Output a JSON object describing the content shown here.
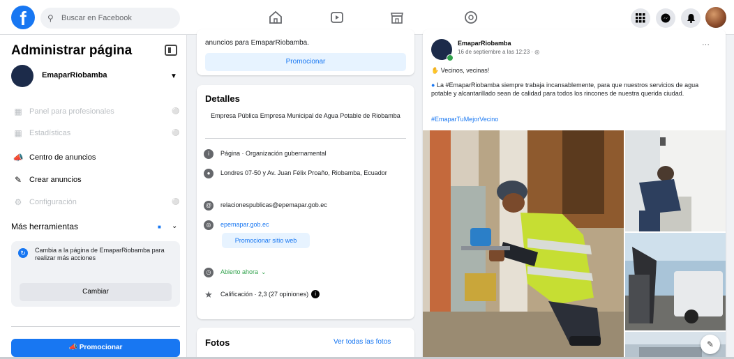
{
  "search": {
    "placeholder": "Buscar en Facebook"
  },
  "sidebar": {
    "title": "Administrar página",
    "page_name": "EmaparRiobamba",
    "items": [
      {
        "label": "Panel para profesionales",
        "enabled": false,
        "icon": "dashboard-icon"
      },
      {
        "label": "Estadísticas",
        "enabled": false,
        "icon": "chart-icon"
      },
      {
        "label": "Centro de anuncios",
        "enabled": true,
        "icon": "megaphone-icon"
      },
      {
        "label": "Crear anuncios",
        "enabled": true,
        "icon": "edit-icon"
      },
      {
        "label": "Configuración",
        "enabled": false,
        "icon": "gear-icon"
      }
    ],
    "more_tools": "Más herramientas",
    "switch_text": "Cambia a la página de EmaparRiobamba para realizar más acciones",
    "switch_button": "Cambiar",
    "promote_button": "Promocionar"
  },
  "top_card": {
    "text": "anuncios para EmaparRiobamba.",
    "button": "Promocionar"
  },
  "details": {
    "title": "Detalles",
    "description": "Empresa Pública Empresa Municipal de Agua Potable de Riobamba",
    "category": "Página · Organización gubernamental",
    "address": "Londres 07-50 y Av. Juan Félix Proaño, Riobamba, Ecuador",
    "email": "relacionespublicas@epemapar.gob.ec",
    "website": "epemapar.gob.ec",
    "website_button": "Promocionar sitio web",
    "hours": "Abierto ahora",
    "rating": "Calificación · 2,3 (27 opiniones)"
  },
  "photos": {
    "title": "Fotos",
    "see_all": "Ver todas las fotos"
  },
  "post": {
    "author": "EmaparRiobamba",
    "time": "16 de septiembre a las 12:23 · ",
    "line1": "Vecinos, vecinas!",
    "line2": "La #EmaparRiobamba siempre trabaja incansablemente, para que nuestros servicios de agua potable y alcantarillado sean de calidad para todos los rincones de nuestra querida ciudad.",
    "hashtag": "#EmaparTuMejorVecino"
  },
  "colors": {
    "brand": "#1877f2",
    "background": "#f0f2f5",
    "open_now": "#31a24c"
  }
}
